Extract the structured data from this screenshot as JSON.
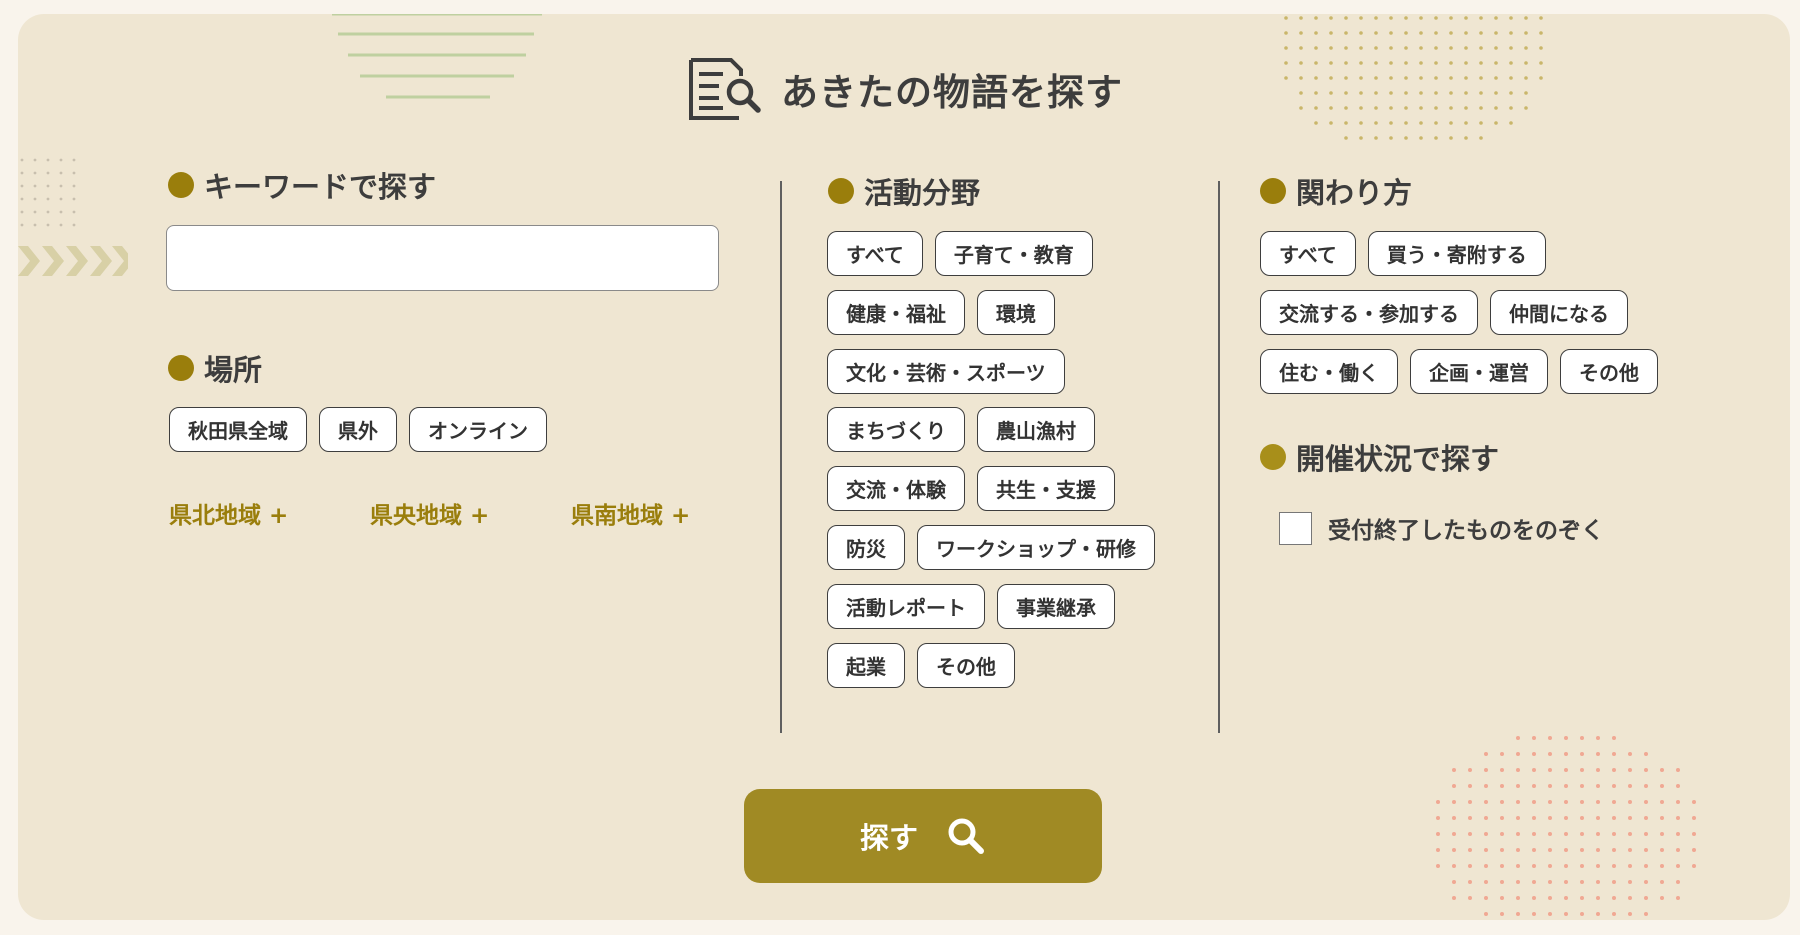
{
  "page_title": "あきたの物語を探す",
  "keyword": {
    "heading": "キーワードで探す",
    "value": "",
    "placeholder": ""
  },
  "place": {
    "heading": "場所",
    "chips": [
      "秋田県全域",
      "県外",
      "オンライン"
    ],
    "regions": [
      "県北地域 +",
      "県央地域 +",
      "県南地域 +"
    ]
  },
  "activity": {
    "heading": "活動分野",
    "rows": [
      [
        "すべて",
        "子育て・教育"
      ],
      [
        "健康・福祉",
        "環境"
      ],
      [
        "文化・芸術・スポーツ"
      ],
      [
        "まちづくり",
        "農山漁村"
      ],
      [
        "交流・体験",
        "共生・支援"
      ],
      [
        "防災",
        "ワークショップ・研修"
      ],
      [
        "活動レポート",
        "事業継承"
      ],
      [
        "起業",
        "その他"
      ]
    ]
  },
  "involvement": {
    "heading": "関わり方",
    "rows": [
      [
        "すべて",
        "買う・寄附する"
      ],
      [
        "交流する・参加する",
        "仲間になる"
      ],
      [
        "住む・働く",
        "企画・運営",
        "その他"
      ]
    ]
  },
  "status": {
    "heading": "開催状況で探す",
    "checkbox_label": "受付終了したものをのぞく",
    "checked": false
  },
  "search_button": {
    "label": "探す",
    "icon": "search-icon"
  },
  "colors": {
    "accent": "#9a7e0c",
    "button": "#a08a24",
    "panel": "#efe6d2",
    "page": "#f9f4ec"
  }
}
